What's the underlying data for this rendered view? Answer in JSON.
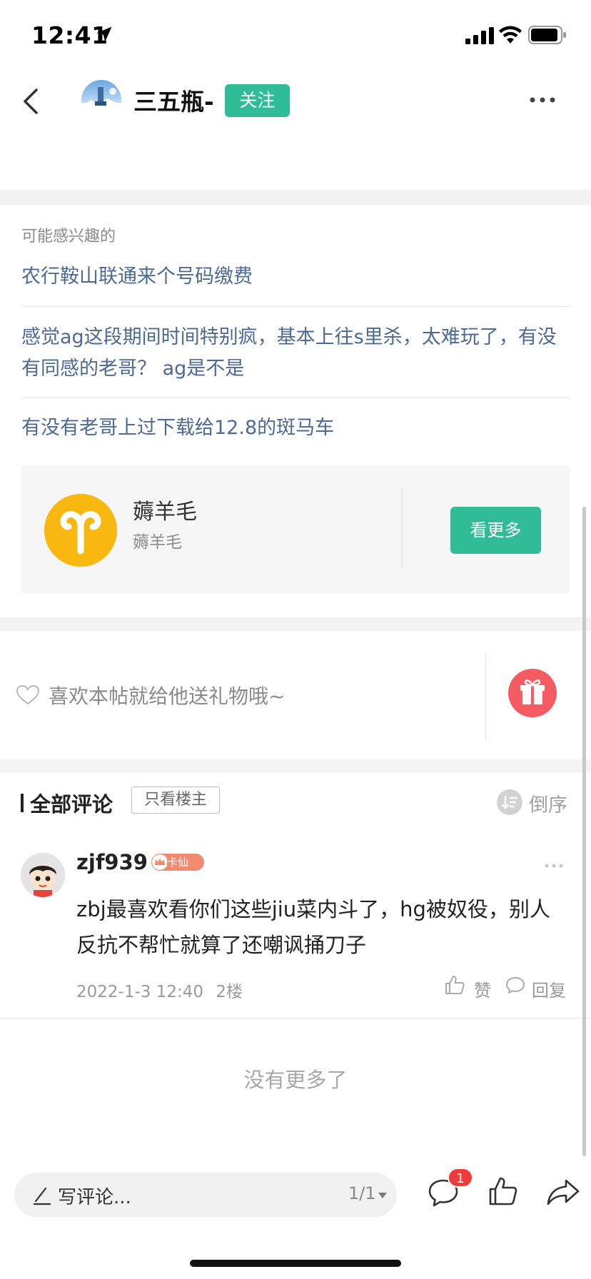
{
  "status_bar": {
    "time": "12:41"
  },
  "header": {
    "username": "三五瓶-",
    "follow_label": "关注"
  },
  "related": {
    "title": "可能感兴趣的",
    "items": [
      "农行鞍山联通来个号码缴费",
      "感觉ag这段期间时间特别疯，基本上往s里杀，太难玩了，有没有同感的老哥？ ag是不是",
      "有没有老哥上过下载给12.8的斑马车"
    ],
    "topic": {
      "name": "薅羊毛",
      "subtitle": "薅羊毛",
      "button_label": "看更多",
      "icon": "aries-icon"
    }
  },
  "gift": {
    "prompt": "喜欢本帖就给他送礼物哦~",
    "icon": "gift-icon"
  },
  "comments": {
    "title": "全部评论",
    "op_only_label": "只看楼主",
    "sort_label": "倒序",
    "list": [
      {
        "user": "zjf939",
        "badge": "卡仙",
        "content": "zbj最喜欢看你们这些jiu菜内斗了，hg被奴役，别人反抗不帮忙就算了还嘲讽捅刀子",
        "date": "2022-1-3 12:40",
        "floor": "2楼",
        "like_label": "赞",
        "reply_label": "回复"
      }
    ],
    "end_text": "没有更多了"
  },
  "bottom_bar": {
    "input_placeholder": "写评论...",
    "page_indicator": "1/1",
    "comment_badge_count": "1"
  },
  "colors": {
    "accent_green": "#2fbc97",
    "link_blue": "#4c6a94",
    "gift_red": "#f45b63",
    "badge_red": "#f13a3a",
    "topic_yellow": "#f8b810"
  }
}
